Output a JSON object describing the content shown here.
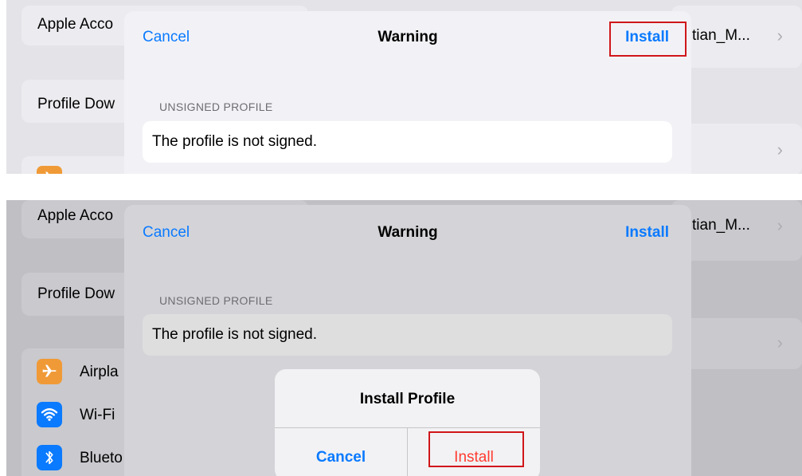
{
  "top": {
    "bg_rows": {
      "apple_account": "Apple Acco",
      "profile_downloaded": "Profile Dow",
      "account_name": "tian_M..."
    },
    "sheet": {
      "cancel": "Cancel",
      "title": "Warning",
      "install": "Install",
      "section_label": "UNSIGNED PROFILE",
      "message": "The profile is not signed."
    }
  },
  "bottom": {
    "bg_rows": {
      "apple_account": "Apple Acco",
      "profile_downloaded": "Profile Dow",
      "account_name": "tian_M...",
      "airplane": "Airpla",
      "wifi": "Wi-Fi",
      "bluetooth": "Blueto"
    },
    "sheet": {
      "cancel": "Cancel",
      "title": "Warning",
      "install": "Install",
      "section_label": "UNSIGNED PROFILE",
      "message": "The profile is not signed."
    },
    "alert": {
      "title": "Install Profile",
      "cancel": "Cancel",
      "install": "Install"
    }
  },
  "chevron": "›",
  "colors": {
    "accent": "#0a7aff",
    "destructive": "#ff3b30",
    "highlight": "#d0161a",
    "airplane_icon": "#f09a37",
    "wifi_icon": "#0a7aff",
    "bluetooth_icon": "#0a7aff"
  },
  "icons": [
    "chevron-right-icon",
    "airplane-icon",
    "wifi-icon",
    "bluetooth-icon"
  ]
}
